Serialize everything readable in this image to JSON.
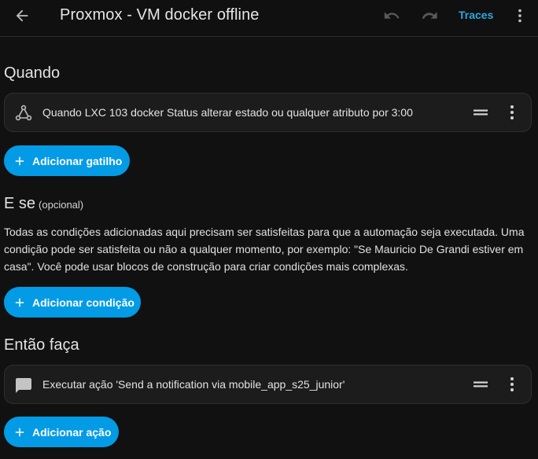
{
  "header": {
    "title": "Proxmox - VM docker offline",
    "traces_label": "Traces",
    "back_icon": "arrow-left-icon",
    "undo_icon": "undo-icon",
    "redo_icon": "redo-icon",
    "menu_icon": "dots-vertical-icon"
  },
  "triggers": {
    "title": "Quando",
    "items": [
      {
        "text": "Quando LXC 103 docker Status alterar estado ou qualquer atributo por 3:00",
        "icon": "state-change-icon"
      }
    ],
    "add_label": "Adicionar gatilho"
  },
  "conditions": {
    "title": "E se",
    "optional": "(opcional)",
    "description": "Todas as condições adicionadas aqui precisam ser satisfeitas para que a automação seja executada. Uma condição pode ser satisfeita ou não a qualquer momento, por exemplo: \"Se Mauricio De Grandi estiver em casa\". Você pode usar blocos de construção para criar condições mais complexas.",
    "add_label": "Adicionar condição"
  },
  "actions": {
    "title": "Então faça",
    "items": [
      {
        "text": "Executar ação 'Send a notification via mobile_app_s25_junior'",
        "icon": "message-icon"
      }
    ],
    "add_label": "Adicionar ação"
  },
  "colors": {
    "background": "#111111",
    "card": "#1c1c1c",
    "accent": "#039be5",
    "link": "#2fa7e0"
  }
}
